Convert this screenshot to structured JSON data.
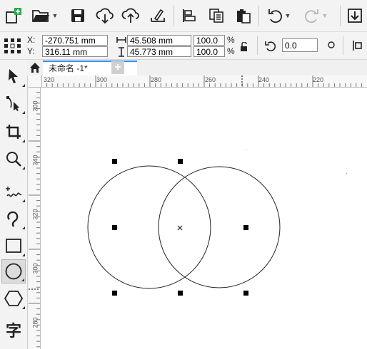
{
  "toolbar": {
    "icons": [
      "new-document-icon",
      "open-folder-icon",
      "save-icon",
      "import-cloud-icon",
      "export-cloud-icon",
      "publish-icon",
      "align-icon",
      "copy-properties-icon",
      "paste-icon",
      "undo-icon",
      "redo-icon",
      "export-icon"
    ]
  },
  "propbar": {
    "x_label": "X:",
    "x_value": "-270.751 mm",
    "y_label": "Y:",
    "y_value": "316.11 mm",
    "width_value": "45.508 mm",
    "height_value": "45.773 mm",
    "scale_x": "100.0",
    "scale_y": "100.0",
    "pct_1": "%",
    "pct_2": "%",
    "rotation_value": "0.0"
  },
  "tabs": {
    "document_label": "未命名 -1*",
    "add_label": "+"
  },
  "ruler": {
    "h_ticks": [
      "320",
      "300",
      "280",
      "260",
      "240",
      "220"
    ],
    "v_ticks": [
      "300",
      "340",
      "320",
      "300",
      "280"
    ]
  },
  "toolbox": {
    "text_tool_glyph": "字"
  },
  "colors": {
    "accent": "#3b8ee6",
    "tab_active_bg": "#ffffff",
    "handle": "#000000"
  }
}
